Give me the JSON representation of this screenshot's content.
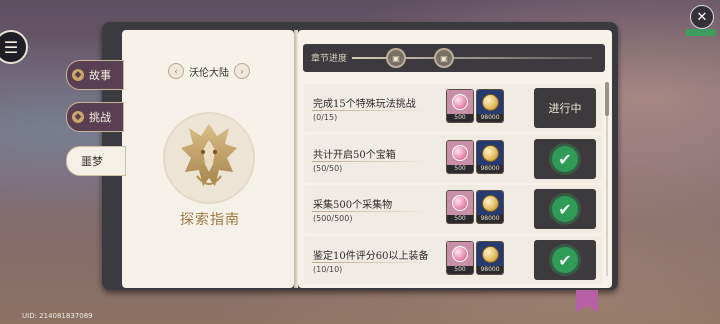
{
  "tabs": [
    {
      "label": "故事",
      "active": true
    },
    {
      "label": "挑战",
      "active": true
    },
    {
      "label": "噩梦",
      "active": false
    }
  ],
  "region": {
    "name": "沃伦大陆",
    "prev_icon": "chevron-left",
    "next_icon": "chevron-right"
  },
  "emblem": {
    "title": "探索指南"
  },
  "progress": {
    "label": "章节进度",
    "milestones": [
      {
        "icon": "chest-icon"
      },
      {
        "icon": "chest-icon"
      }
    ]
  },
  "tasks": [
    {
      "name": "完成15个特殊玩法挑战",
      "count": "(0/15)",
      "rewards": [
        {
          "icon": "gem-icon",
          "qty": "500"
        },
        {
          "icon": "coin-icon",
          "qty": "98000"
        }
      ],
      "status": "进行中",
      "completed": false
    },
    {
      "name": "共计开启50个宝箱",
      "count": "(50/50)",
      "rewards": [
        {
          "icon": "gem-icon",
          "qty": "500"
        },
        {
          "icon": "coin-icon",
          "qty": "98000"
        }
      ],
      "status": "",
      "completed": true
    },
    {
      "name": "采集500个采集物",
      "count": "(500/500)",
      "rewards": [
        {
          "icon": "gem-icon",
          "qty": "500"
        },
        {
          "icon": "coin-icon",
          "qty": "98000"
        }
      ],
      "status": "",
      "completed": true
    },
    {
      "name": "鉴定10件评分60以上装备",
      "count": "(10/10)",
      "rewards": [
        {
          "icon": "gem-icon",
          "qty": "500"
        },
        {
          "icon": "coin-icon",
          "qty": "98000"
        }
      ],
      "status": "",
      "completed": true
    }
  ],
  "uid": "UID: 214081837089",
  "glyphs": {
    "menu": "☰",
    "close": "✕",
    "prev": "‹",
    "next": "›",
    "check": "✔",
    "chest": "▣"
  },
  "colors": {
    "completed": "#2f9b56",
    "accent_gold": "#9d7a45",
    "active_tab": "#5a3e52",
    "bookmark": "#b860a6"
  }
}
